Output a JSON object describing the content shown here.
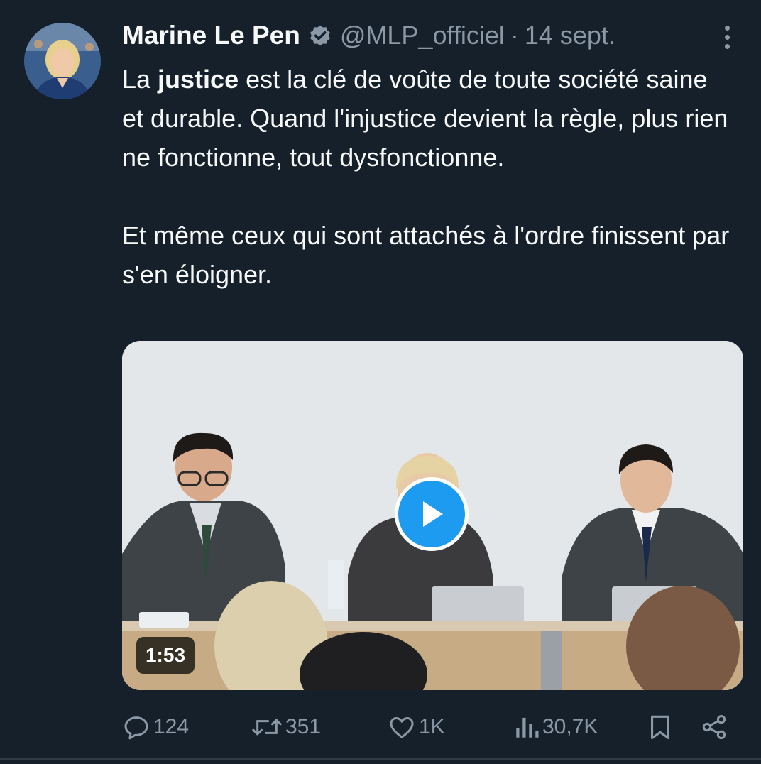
{
  "author": {
    "name": "Marine Le Pen",
    "handle": "@MLP_officiel",
    "separator": "·",
    "date": "14 sept."
  },
  "tweet": {
    "p1_pre": "La ",
    "p1_bold": "justice",
    "p1_post": " est la clé de voûte de toute société saine et durable. Quand l'injustice devient la règle, plus rien ne fonctionne, tout dysfonctionne.",
    "p2": "Et même ceux qui sont attachés à l'ordre finissent par s'en éloigner."
  },
  "media": {
    "duration": "1:53"
  },
  "actions": {
    "replies": "124",
    "retweets": "351",
    "likes": "1K",
    "views": "30,7K"
  },
  "colors": {
    "background": "#15202b",
    "accent": "#1d9bf0",
    "muted": "#8b98a5"
  },
  "icons": {
    "verified": "verified-badge-icon",
    "more": "more-options-icon",
    "reply": "reply-icon",
    "retweet": "retweet-icon",
    "like": "heart-icon",
    "views": "views-icon",
    "bookmark": "bookmark-icon",
    "share": "share-icon",
    "play": "play-icon"
  }
}
